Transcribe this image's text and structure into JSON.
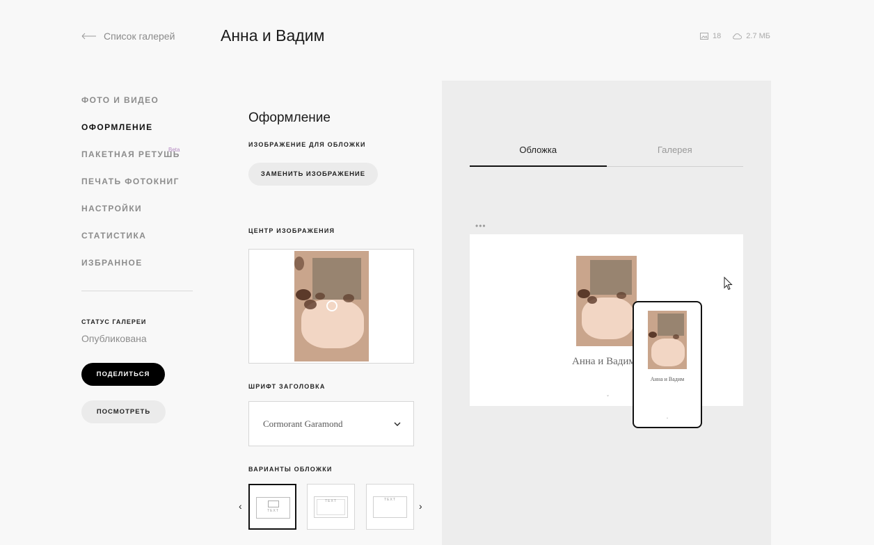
{
  "header": {
    "back_label": "Список галерей",
    "title": "Анна и Вадим",
    "photo_count": "18",
    "storage": "2.7 МБ"
  },
  "nav": {
    "items": [
      {
        "label": "ФОТО И ВИДЕО",
        "active": false
      },
      {
        "label": "ОФОРМЛЕНИЕ",
        "active": true
      },
      {
        "label": "ПАКЕТНАЯ РЕТУШЬ",
        "active": false,
        "badge": "Beta"
      },
      {
        "label": "ПЕЧАТЬ ФОТОКНИГ",
        "active": false
      },
      {
        "label": "НАСТРОЙКИ",
        "active": false
      },
      {
        "label": "СТАТИСТИКА",
        "active": false
      },
      {
        "label": "ИЗБРАННОЕ",
        "active": false
      }
    ],
    "status_label": "СТАТУС ГАЛЕРЕИ",
    "status_value": "Опубликована",
    "share_label": "ПОДЕЛИТЬСЯ",
    "view_label": "ПОСМОТРЕТЬ"
  },
  "design": {
    "title": "Оформление",
    "cover_image_label": "ИЗОБРАЖЕНИЕ ДЛЯ ОБЛОЖКИ",
    "replace_button": "ЗАМЕНИТЬ ИЗОБРАЖЕНИЕ",
    "image_center_label": "ЦЕНТР ИЗОБРАЖЕНИЯ",
    "title_font_label": "ШРИФТ ЗАГОЛОВКА",
    "title_font_value": "Cormorant Garamond",
    "cover_variants_label": "ВАРИАНТЫ ОБЛОЖКИ",
    "variant_text": "TEXT",
    "prev_arrow": "‹",
    "next_arrow": "›"
  },
  "preview": {
    "tabs": [
      {
        "label": "Обложка",
        "active": true
      },
      {
        "label": "Галерея",
        "active": false
      }
    ],
    "more": "•••",
    "desktop_title": "Анна и Вадим",
    "phone_title": "Анна и Вадим",
    "chevron": "⌄"
  },
  "colors": {
    "accent": "#111111",
    "beta_badge": "#b58ac2",
    "panel_bg": "#ededed"
  }
}
